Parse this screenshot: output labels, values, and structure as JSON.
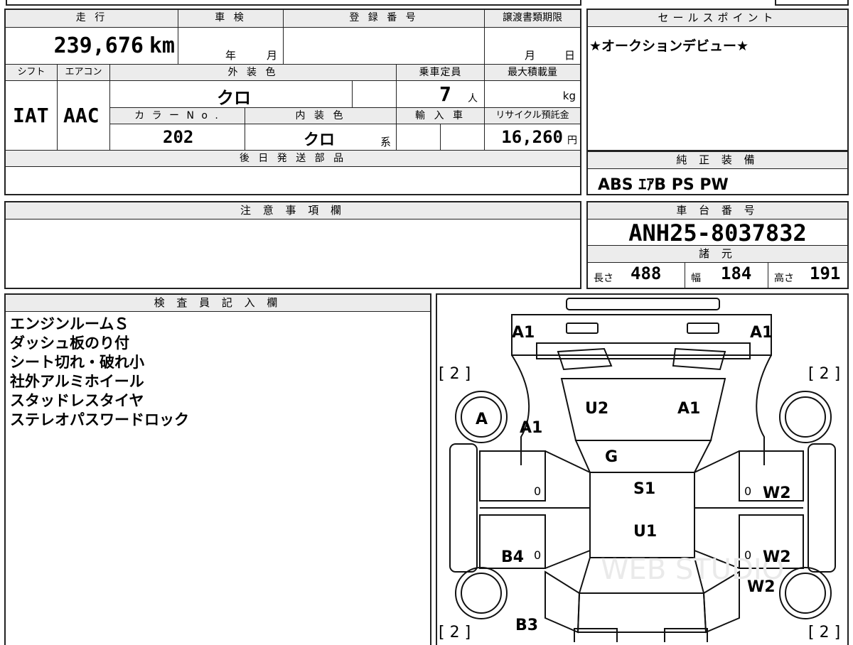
{
  "vehicle": {
    "mileage_label": "走 行",
    "mileage": "239,676",
    "mileage_unit": "km",
    "inspection_label": "車 検",
    "year_unit": "年",
    "month_unit": "月",
    "registration_label": "登 録 番 号",
    "transfer_deadline_label": "譲渡書類期限",
    "day_unit": "日",
    "shift_label": "シフト",
    "shift": "IAT",
    "aircon_label": "エアコン",
    "aircon": "AAC",
    "exterior_color_label": "外 装 色",
    "exterior_color": "クロ",
    "capacity_label": "乗車定員",
    "capacity": "7",
    "capacity_unit": "人",
    "max_load_label": "最大積載量",
    "max_load_unit": "kg",
    "color_no_label": "カ ラ ー N o .",
    "color_no": "202",
    "interior_color_label": "内 装 色",
    "interior_color": "クロ",
    "interior_suffix": "系",
    "import_label": "輸 入 車",
    "recycle_label": "リサイクル預託金",
    "recycle_fee": "16,260",
    "recycle_unit": "円",
    "later_parts_label": "後 日 発 送 部 品"
  },
  "sales_points": {
    "label": "セールスポイント",
    "text": "★オークションデビュー★"
  },
  "standard_equipment": {
    "label": "純 正 装 備",
    "text": "ABS ｴｱB PS PW"
  },
  "notes": {
    "label": "注 意 事 項 欄"
  },
  "chassis": {
    "label": "車 台 番 号",
    "number": "ANH25-8037832",
    "specs_label": "諸 元",
    "length_label": "長さ",
    "length": "488",
    "width_label": "幅",
    "width": "184",
    "height_label": "高さ",
    "height": "191"
  },
  "inspector": {
    "label": "検 査 員 記 入 欄",
    "lines": [
      "エンジンルームＳ",
      "ダッシュ板のり付",
      "シート切れ・破れ小",
      "社外アルミホイール",
      "スタッドレスタイヤ",
      "ステレオパスワードロック"
    ]
  },
  "damage_map": {
    "marks": {
      "front_left_corner": "A1",
      "front_right_corner": "A1",
      "bracket_left_top": "[ 2 ]",
      "bracket_right_top": "[ 2 ]",
      "bracket_left_bottom": "[ 2 ]",
      "bracket_right_bottom": "[ 2 ]",
      "wheel_front_left": "A",
      "fender_front_left": "A1",
      "windshield_left": "U2",
      "windshield_right": "A1",
      "dash": "G",
      "roof_front": "S1",
      "roof_rear": "U1",
      "door_left_front_count": "0",
      "door_left_rear_count": "0",
      "door_left_rear": "B4",
      "door_right_front_count": "0",
      "door_right_front": "W2",
      "door_right_rear_count": "0",
      "door_right_rear": "W2",
      "rear_right_fender": "W2",
      "rear_left": "B3"
    },
    "watermark": "WEB STUDIO"
  }
}
